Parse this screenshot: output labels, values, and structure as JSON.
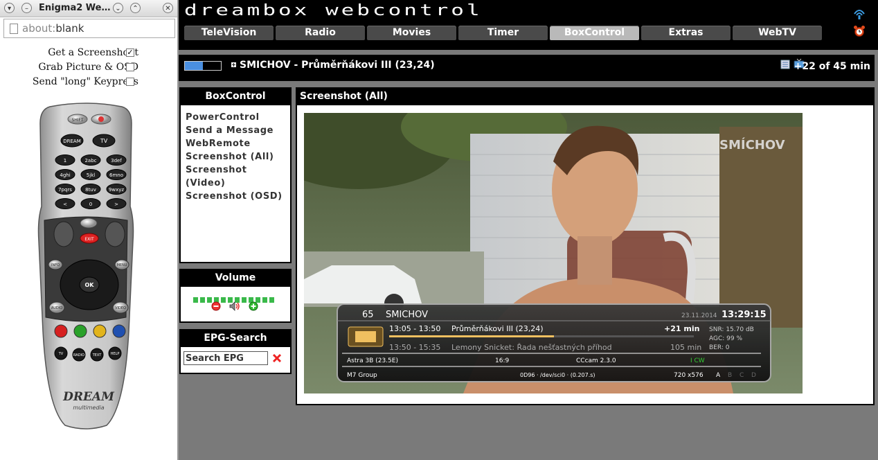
{
  "popup": {
    "title": "Enigma2 We…",
    "address_scheme": "about:",
    "address_path": "blank",
    "options": [
      {
        "label": "Get a Screenshoot",
        "checked": true
      },
      {
        "label": "Grab Picture & OSD",
        "checked": false
      },
      {
        "label": "Send \"long\" Keypress",
        "checked": false
      }
    ],
    "remote": {
      "keys_top": [
        "SHIFT",
        "DREAM",
        "TV"
      ],
      "digits": [
        "1",
        "2abc",
        "3def",
        "4ghi",
        "5jkl",
        "6mno",
        "7pqrs",
        "8tuv",
        "9wxyz",
        "<",
        "0",
        ">"
      ],
      "keys_mid": [
        "EXIT",
        "INFO",
        "MENU",
        "OK",
        "AUDIO",
        "VIDEO"
      ],
      "keys_bottom": [
        "TV",
        "RADIO",
        "TEXT",
        "HELP"
      ],
      "brand": "DREAM",
      "brand_sub": "multimedia"
    }
  },
  "header": {
    "logo": "dreambox webcontrol",
    "nav": [
      "TeleVision",
      "Radio",
      "Movies",
      "Timer",
      "BoxControl",
      "Extras",
      "WebTV"
    ],
    "active_nav": "BoxControl"
  },
  "current": {
    "title": "SMICHOV - Průměrňákovi III (23,24)",
    "remaining": "+22 of 45 min",
    "progress_fraction": 0.5
  },
  "boxcontrol": {
    "heading": "BoxControl",
    "links": [
      "PowerControl",
      "Send a Message",
      "WebRemote",
      "Screenshot (All)",
      "Screenshot (Video)",
      "Screenshot (OSD)"
    ]
  },
  "volume": {
    "heading": "Volume",
    "level_bars": 12
  },
  "epg": {
    "heading": "EPG-Search",
    "input_value": "Search EPG"
  },
  "main": {
    "heading": "Screenshot (All)"
  },
  "screenshot": {
    "watermark": "SMÍCHOV",
    "osd": {
      "channel_num": "65",
      "channel_name": "SMICHOV",
      "date": "23.11.2014",
      "time": "13:29:15",
      "now_time": "13:05 - 13:50",
      "now_title": "Průměrňákovi III (23,24)",
      "now_remain": "+21 min",
      "next_time": "13:50 - 15:35",
      "next_title": "Lemony Snicket: Řada nešťastných příhod",
      "next_len": "105 min",
      "snr": "SNR: 15.70 dB",
      "agc": "AGC: 99 %",
      "ber": "BER: 0",
      "sat": "Astra 3B (23.5E)",
      "aspect": "16:9",
      "cam": "CCcam 2.3.0",
      "cw": "I CW",
      "provider": "M7 Group",
      "pid": "0D96 · /dev/sci0 · (0.207.s)",
      "resolution": "720 x576",
      "abcd": [
        "A",
        "B",
        "C",
        "D"
      ]
    }
  },
  "colors": {
    "header_bg": "#000000",
    "nav_bg": "#4a4a4a",
    "nav_active": "#b9b9b9",
    "signal_fill": "#4a8fe0",
    "volume_green": "#3ab94a",
    "page_bg": "#7a7a7a"
  }
}
